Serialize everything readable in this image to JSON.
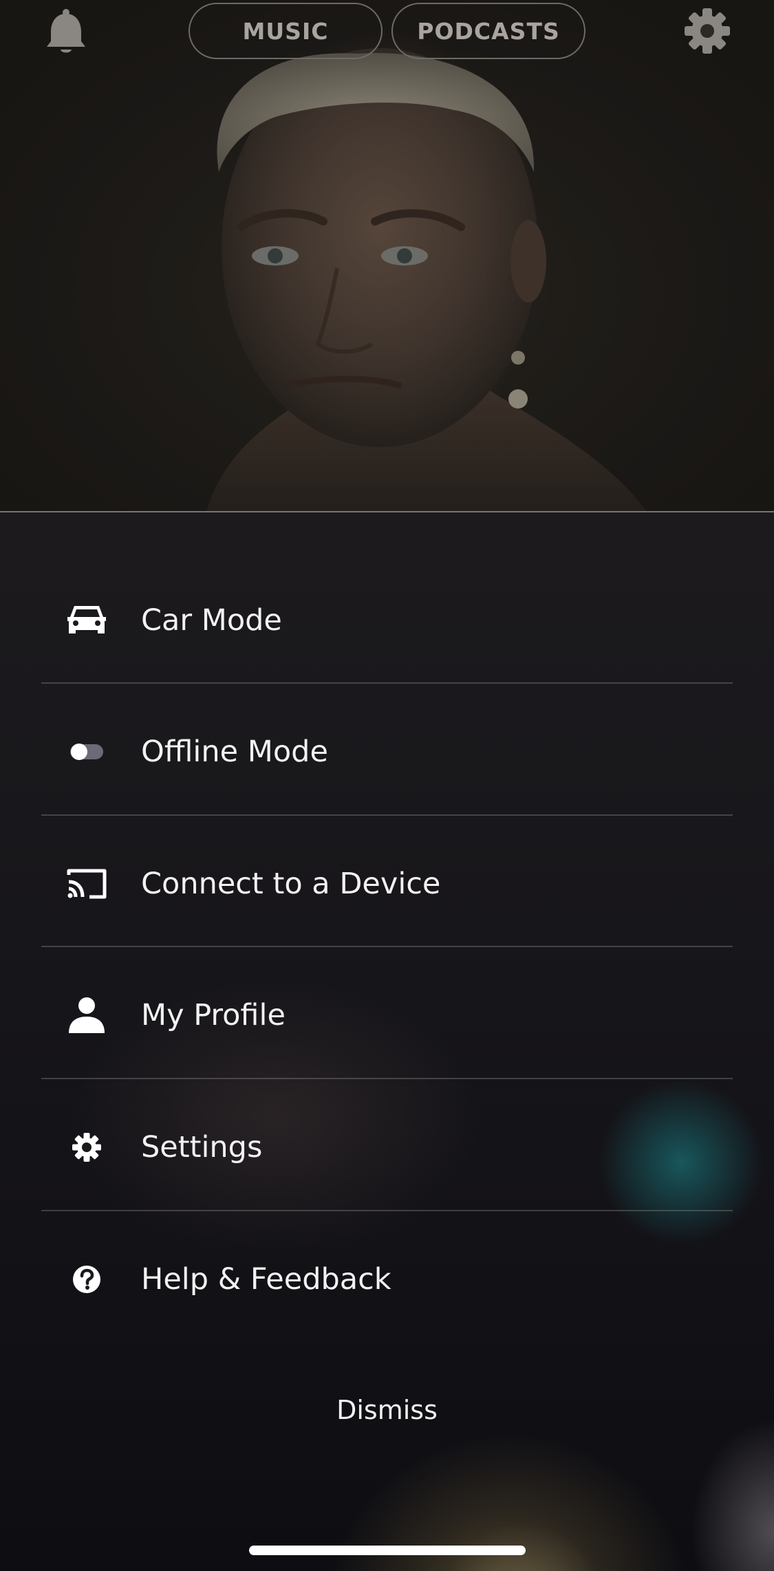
{
  "header": {
    "tabs": [
      {
        "label": "MUSIC"
      },
      {
        "label": "PODCASTS"
      }
    ],
    "icons": {
      "notifications": "bell-icon",
      "settings": "gear-icon"
    }
  },
  "menu": {
    "items": [
      {
        "label": "Car Mode",
        "icon": "car-icon"
      },
      {
        "label": "Offline Mode",
        "icon": "toggle-icon"
      },
      {
        "label": "Connect to a Device",
        "icon": "cast-icon"
      },
      {
        "label": "My Profile",
        "icon": "person-icon"
      },
      {
        "label": "Settings",
        "icon": "gear-icon"
      },
      {
        "label": "Help & Feedback",
        "icon": "help-icon"
      }
    ],
    "dismiss_label": "Dismiss"
  },
  "colors": {
    "text": "#f2f2f2",
    "pill_text": "#a9a49f",
    "teal_glow": "#196e73",
    "divider": "#7a7570"
  }
}
